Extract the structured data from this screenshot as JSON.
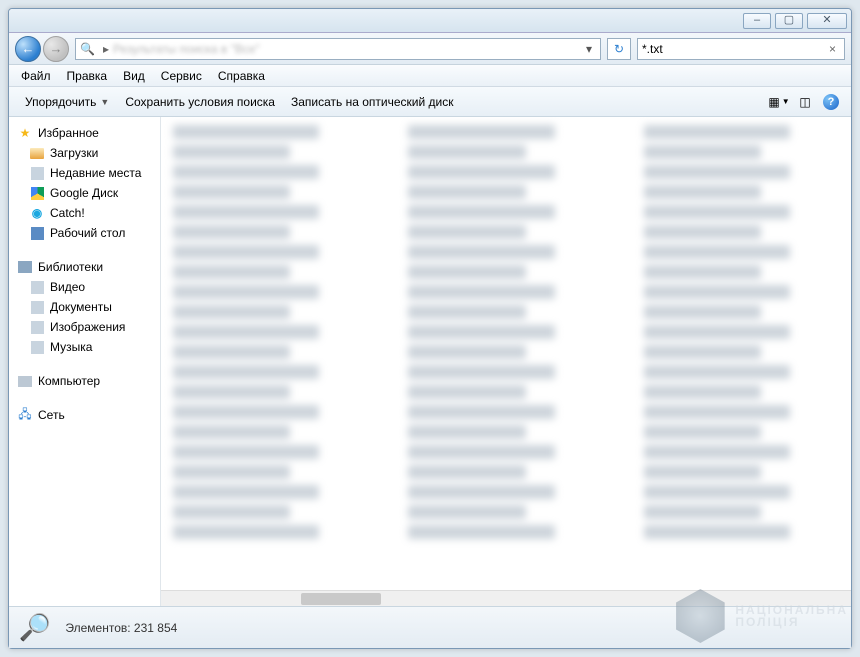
{
  "titlebar": {
    "min": "–",
    "max": "▢",
    "close": "✕"
  },
  "nav": {
    "back": "←",
    "fwd": "→",
    "path_hint": "Результаты поиска в \"Все\"",
    "refresh": "↻",
    "search_value": "*.txt",
    "search_clear": "×"
  },
  "menu": {
    "file": "Файл",
    "edit": "Правка",
    "view": "Вид",
    "tools": "Сервис",
    "help": "Справка"
  },
  "toolbar": {
    "organize": "Упорядочить",
    "save_search": "Сохранить условия поиска",
    "burn": "Записать на оптический диск",
    "help_glyph": "?"
  },
  "sidebar": {
    "favorites": {
      "label": "Избранное",
      "items": [
        {
          "label": "Загрузки"
        },
        {
          "label": "Недавние места"
        },
        {
          "label": "Google Диск"
        },
        {
          "label": "Catch!"
        },
        {
          "label": "Рабочий стол"
        }
      ]
    },
    "libraries": {
      "label": "Библиотеки",
      "items": [
        {
          "label": "Видео"
        },
        {
          "label": "Документы"
        },
        {
          "label": "Изображения"
        },
        {
          "label": "Музыка"
        }
      ]
    },
    "computer": {
      "label": "Компьютер"
    },
    "network": {
      "label": "Сеть"
    }
  },
  "status": {
    "items_label": "Элементов:",
    "items_count": "231 854"
  },
  "watermark": {
    "line1": "НАЦІОНАЛЬНА",
    "line2": "ПОЛІЦІЯ"
  }
}
